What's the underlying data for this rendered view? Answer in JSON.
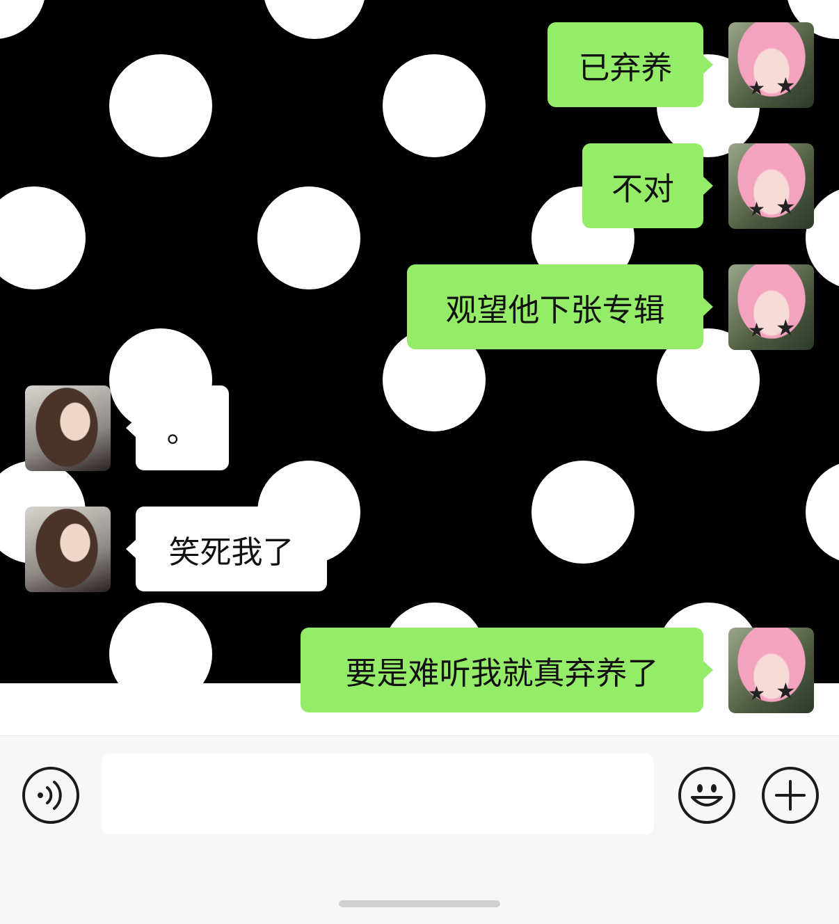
{
  "messages": [
    {
      "side": "sent",
      "text": "已弃养",
      "avatar": "pink-hair-avatar"
    },
    {
      "side": "sent",
      "text": "不对",
      "avatar": "pink-hair-avatar"
    },
    {
      "side": "sent",
      "text": "观望他下张专辑",
      "avatar": "pink-hair-avatar"
    },
    {
      "side": "received",
      "text": "。",
      "avatar": "brown-hair-avatar"
    },
    {
      "side": "received",
      "text": "笑死我了",
      "avatar": "brown-hair-avatar"
    },
    {
      "side": "sent",
      "text": "要是难听我就真弃养了",
      "avatar": "pink-hair-avatar"
    }
  ],
  "input_bar": {
    "voice_icon": "voice-input-icon",
    "text_value": "",
    "emoji_icon": "emoji-icon",
    "plus_icon": "plus-icon"
  },
  "colors": {
    "sent_bubble": "#95ec69",
    "received_bubble": "#ffffff",
    "wallpaper": "#000000",
    "input_bar": "#f7f7f7"
  }
}
